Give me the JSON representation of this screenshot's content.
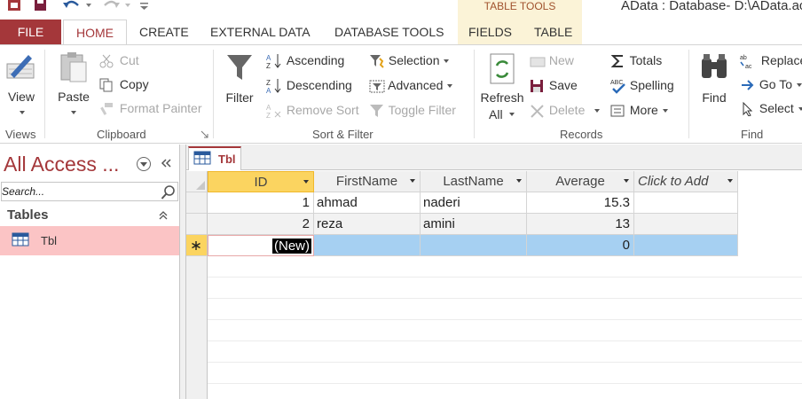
{
  "window": {
    "title": "AData : Database- D:\\AData.ac"
  },
  "context_tab_group": "TABLE TOOLS",
  "tabs": [
    "FILE",
    "HOME",
    "CREATE",
    "EXTERNAL DATA",
    "DATABASE TOOLS",
    "FIELDS",
    "TABLE"
  ],
  "ribbon": {
    "views": {
      "view": "View",
      "group": "Views"
    },
    "clipboard": {
      "paste": "Paste",
      "cut": "Cut",
      "copy": "Copy",
      "format_painter": "Format Painter",
      "group": "Clipboard"
    },
    "sort_filter": {
      "filter": "Filter",
      "ascending": "Ascending",
      "descending": "Descending",
      "remove_sort": "Remove Sort",
      "selection": "Selection",
      "advanced": "Advanced",
      "toggle_filter": "Toggle Filter",
      "group": "Sort & Filter"
    },
    "records": {
      "refresh": "Refresh",
      "refresh_all": "All",
      "new": "New",
      "save": "Save",
      "delete": "Delete",
      "totals": "Totals",
      "spelling": "Spelling",
      "more": "More",
      "group": "Records"
    },
    "find": {
      "find": "Find",
      "replace": "Replace",
      "goto": "Go To",
      "select": "Select",
      "group": "Find"
    }
  },
  "nav": {
    "title": "All Access ...",
    "search_placeholder": "Search...",
    "section": "Tables",
    "items": [
      "Tbl"
    ]
  },
  "document_tab": "Tbl",
  "table": {
    "columns": [
      "ID",
      "FirstName",
      "LastName",
      "Average",
      "Click to Add"
    ],
    "rows": [
      {
        "id": "1",
        "first": "ahmad",
        "last": "naderi",
        "avg": "15.3"
      },
      {
        "id": "2",
        "first": "reza",
        "last": "amini",
        "avg": "13"
      }
    ],
    "new_row": {
      "id": "(New)",
      "avg": "0"
    }
  },
  "colors": {
    "accent": "#a4373a",
    "context_band": "#fbf3d7",
    "selection_blue": "#a6d0f2",
    "header_gold": "#fbd460"
  }
}
